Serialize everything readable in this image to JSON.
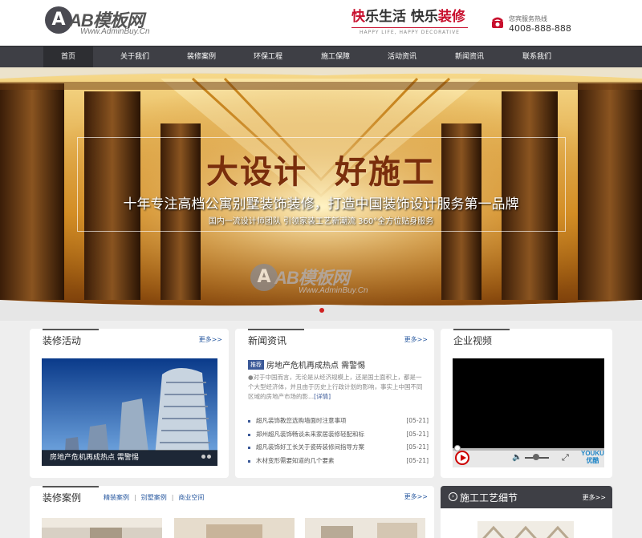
{
  "header": {
    "logo_text": "AB模板网",
    "logo_sub": "Www.AdminBuy.Cn",
    "slogan_red1": "快",
    "slogan_mid1": "乐生活 ",
    "slogan_mid2": "快乐",
    "slogan_red2": "装修",
    "slogan_sub": "HAPPY LIFE, HAPPY DECORATIVE",
    "hotline_label": "您宾服务热线",
    "hotline_number": "4008-888-888"
  },
  "nav": {
    "items": [
      "首页",
      "关于我们",
      "装修案例",
      "环保工程",
      "施工保障",
      "活动资讯",
      "新闻资讯",
      "联系我们"
    ]
  },
  "banner": {
    "title": "大设计 好施工",
    "subtitle": "十年专注高档公寓别墅装饰装修，打造中国装饰设计服务第一品牌",
    "subtitle2": "国内一流设计师团队  引领家装工艺新潮流  360°全方位贴身服务",
    "watermark_text": "AB模板网",
    "watermark_sub": "Www.AdminBuy.Cn"
  },
  "activities": {
    "title": "装修活动",
    "more": "更多>>",
    "caption": "房地产危机再成热点 需警惕"
  },
  "news": {
    "title": "新闻资讯",
    "more": "更多>>",
    "tag": "推荐",
    "top_title": "房地产危机再成热点 需警惕",
    "summary": "●对于中国而言，无论是从经济规模上，还是国土面积上，都是一个大型经济体，并且由于历史上行政计划的影响，事实上中国不同区域的房地产市场的影...",
    "summary_link": "[详情]",
    "list": [
      {
        "title": "超凡装饰教您选购墙面时注意事项",
        "date": "[05-21]"
      },
      {
        "title": "郑州超凡装饰畅谈未来家居装修轻配和标",
        "date": "[05-21]"
      },
      {
        "title": "超凡装饰好工长关于瓷砖装修间指导方案",
        "date": "[05-21]"
      },
      {
        "title": "木材变形需要知道的几个要素",
        "date": "[05-21]"
      }
    ]
  },
  "video": {
    "title": "企业视频",
    "youku_top": "YOUKU",
    "youku_bottom": "优酷"
  },
  "cases": {
    "title": "装修案例",
    "tabs": [
      "精装案例",
      "别墅案例",
      "商业空间"
    ],
    "more": "更多>>"
  },
  "craft": {
    "title": "施工工艺细节",
    "more": "更多>>"
  }
}
